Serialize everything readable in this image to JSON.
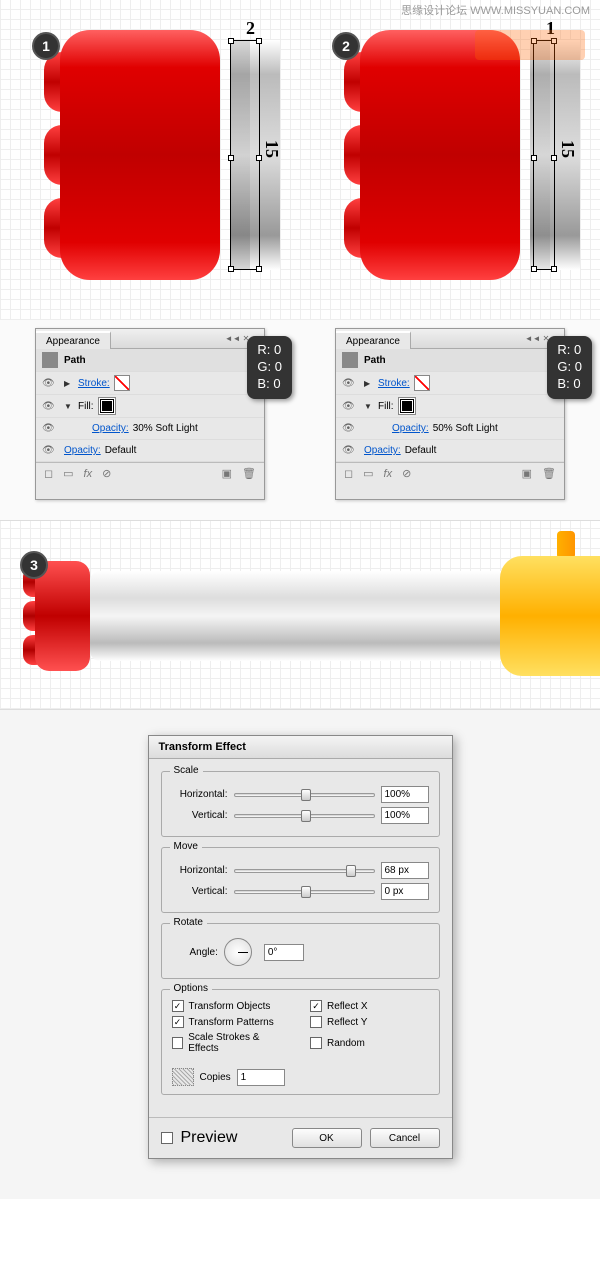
{
  "watermark": "思缘设计论坛  WWW.MISSYUAN.COM",
  "badge1": "1",
  "badge2": "2",
  "badge3": "3",
  "dim_w1": "2",
  "dim_h1": "15",
  "dim_w2": "1",
  "dim_h2": "15",
  "panel": {
    "tab": "Appearance",
    "path": "Path",
    "stroke": "Stroke:",
    "fill": "Fill:",
    "opacity_label": "Opacity:",
    "op1": "30% Soft Light",
    "op2": "50% Soft Light",
    "op_default": "Default",
    "fx": "fx"
  },
  "rgb": {
    "r": "R: 0",
    "g": "G: 0",
    "b": "B: 0"
  },
  "dialog": {
    "title": "Transform Effect",
    "scale_legend": "Scale",
    "move_legend": "Move",
    "rotate_legend": "Rotate",
    "options_legend": "Options",
    "horizontal": "Horizontal:",
    "vertical": "Vertical:",
    "angle": "Angle:",
    "scale_h": "100%",
    "scale_v": "100%",
    "move_h": "68 px",
    "move_v": "0 px",
    "angle_v": "0°",
    "transform_objects": "Transform Objects",
    "transform_patterns": "Transform Patterns",
    "scale_strokes": "Scale Strokes & Effects",
    "reflect_x": "Reflect X",
    "reflect_y": "Reflect Y",
    "random": "Random",
    "copies": "Copies",
    "copies_v": "1",
    "preview": "Preview",
    "ok": "OK",
    "cancel": "Cancel",
    "chk_transform_objects": true,
    "chk_transform_patterns": true,
    "chk_scale_strokes": false,
    "chk_reflect_x": true,
    "chk_reflect_y": false,
    "chk_random": false,
    "chk_preview": false
  }
}
